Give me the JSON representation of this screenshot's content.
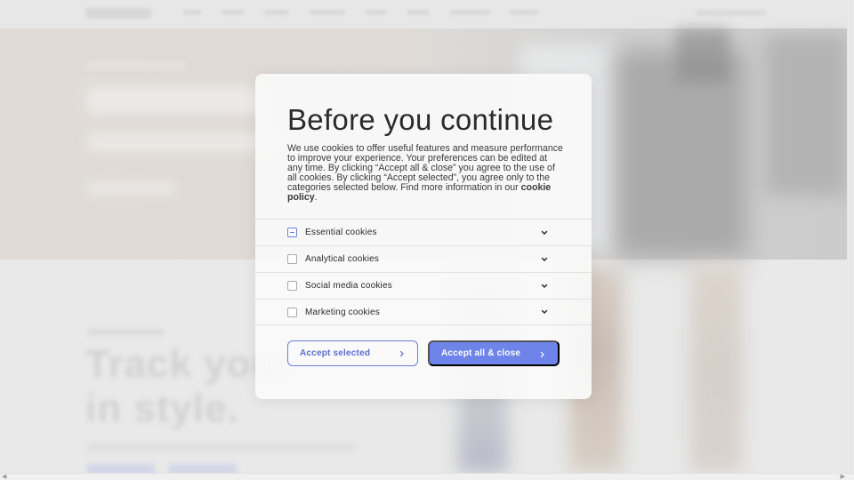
{
  "modal": {
    "title": "Before you continue",
    "description": "We use cookies to offer useful features and measure performance to improve your experience. Your preferences can be edited at any time. By clicking “Accept all & close” you agree to the use of all cookies. By clicking “Accept selected”, you agree only to the categories selected below. Find more information in our",
    "policy_link": "cookie policy",
    "policy_suffix": ".",
    "categories": [
      {
        "label": "Essential cookies",
        "state": "indeterminate",
        "icon": "chevron-down-icon"
      },
      {
        "label": "Analytical cookies",
        "state": "unchecked",
        "icon": "chevron-down-icon"
      },
      {
        "label": "Social media cookies",
        "state": "unchecked",
        "icon": "chevron-down-icon"
      },
      {
        "label": "Marketing cookies",
        "state": "unchecked",
        "icon": "chevron-down-icon"
      }
    ],
    "accept_selected_label": "Accept selected",
    "accept_all_label": "Accept all & close",
    "button_icon": "chevron-right-icon"
  },
  "background": {
    "headline": "Track your ... in style."
  },
  "colors": {
    "accent": "#6e84e8",
    "accent_border": "#6a7fd6",
    "title_text": "#2b2b2b",
    "overlay_modal_bg": "#fafafa"
  },
  "scrollbar": {
    "left_arrow": "◀",
    "right_arrow": "▶"
  }
}
